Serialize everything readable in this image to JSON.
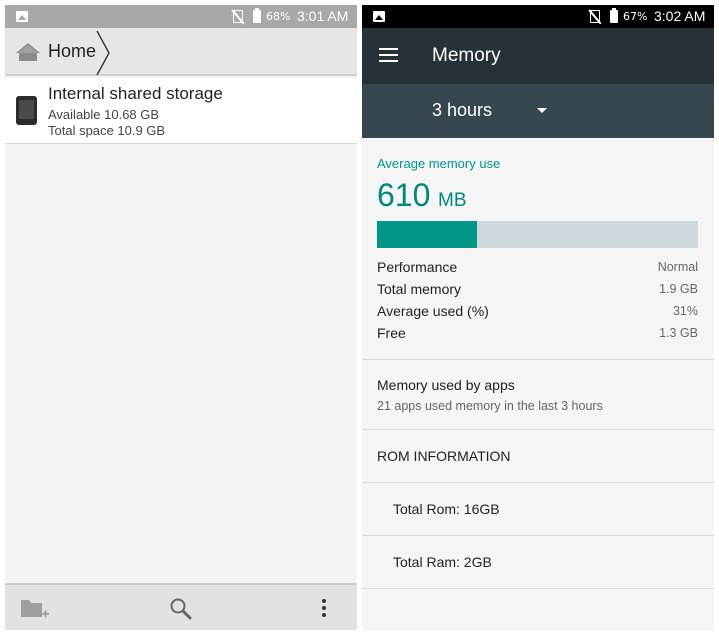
{
  "left_screen": {
    "status_bar": {
      "battery_percent": "68%",
      "time": "3:01 AM",
      "icons": [
        "image-icon",
        "no-sim-icon",
        "battery-icon"
      ]
    },
    "breadcrumb": {
      "label": "Home",
      "icon": "home-icon"
    },
    "storage": {
      "title": "Internal shared storage",
      "available": "Available 10.68 GB",
      "total": "Total space 10.9 GB",
      "icon": "phone-device-icon"
    },
    "bottom_bar": {
      "icons": [
        "new-folder-icon",
        "search-icon",
        "more-vert-icon"
      ]
    }
  },
  "right_screen": {
    "status_bar": {
      "battery_percent": "67%",
      "time": "3:02 AM",
      "icons": [
        "image-icon",
        "no-sim-icon",
        "battery-icon"
      ]
    },
    "toolbar": {
      "title": "Memory",
      "menu_icon": "menu-icon"
    },
    "spinner": {
      "selected": "3 hours"
    },
    "average": {
      "label": "Average memory use",
      "value": "610",
      "unit": "MB",
      "usage_fraction": 0.31
    },
    "stats": [
      {
        "label": "Performance",
        "value": "Normal"
      },
      {
        "label": "Total memory",
        "value": "1.9 GB"
      },
      {
        "label": "Average used (%)",
        "value": "31%"
      },
      {
        "label": "Free",
        "value": "1.3 GB"
      }
    ],
    "apps": {
      "title": "Memory used by apps",
      "subtitle": "21 apps used memory in the last 3 hours"
    },
    "rom": {
      "header": "ROM INFORMATION",
      "total_rom": "Total Rom: 16GB",
      "total_ram": "Total Ram: 2GB"
    },
    "colors": {
      "accent": "#009688",
      "toolbar": "#263238",
      "spinner_bar": "#37474f",
      "bar_track": "#cfd8dc"
    }
  }
}
